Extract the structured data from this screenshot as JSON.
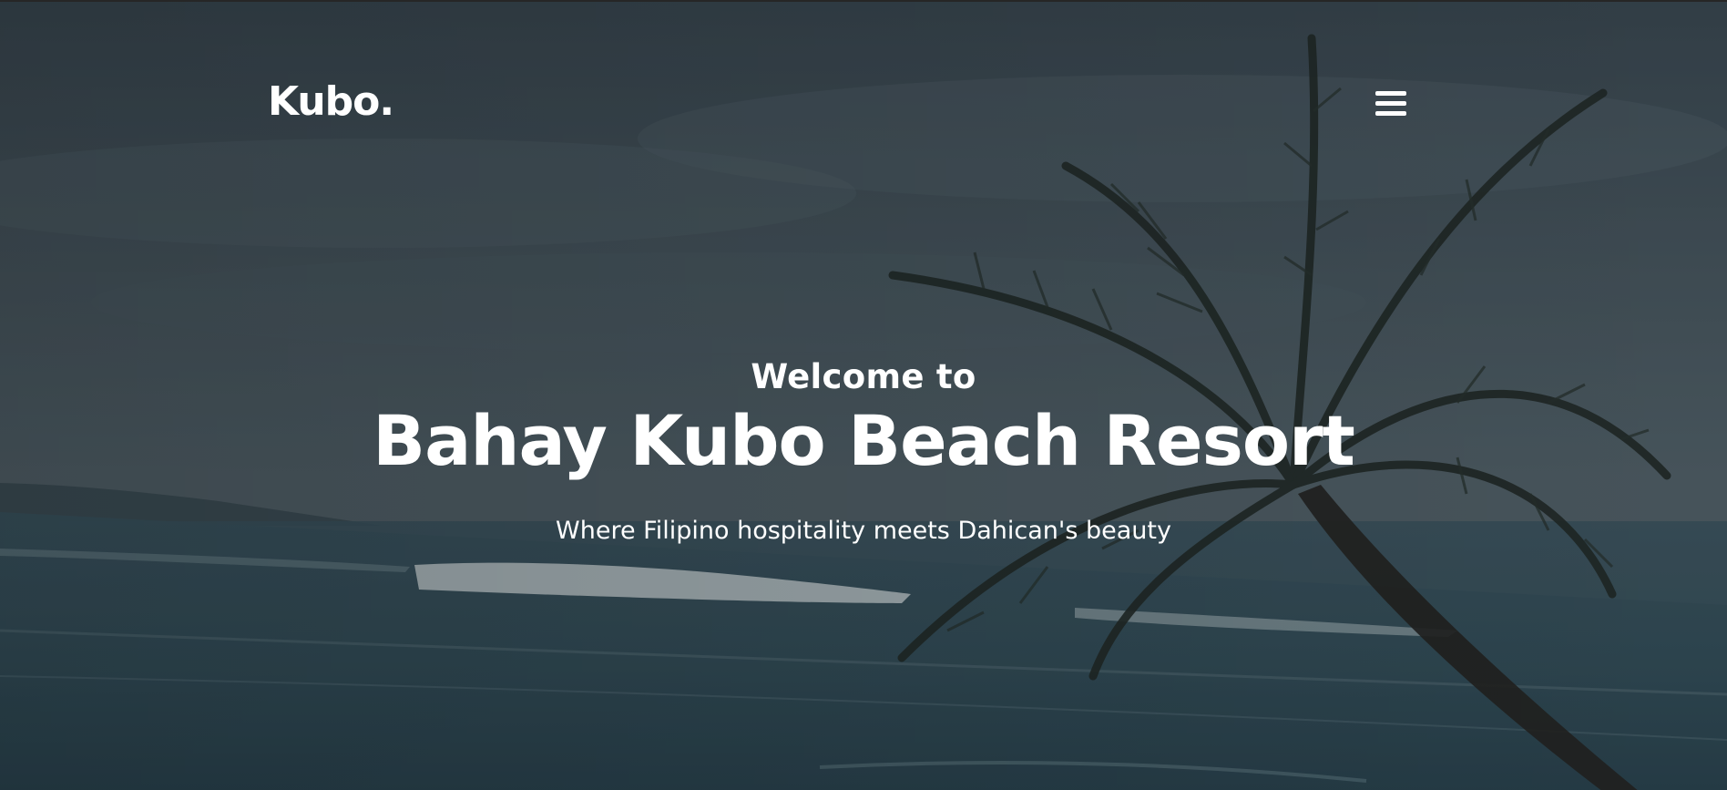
{
  "header": {
    "logo_text": "Kubo",
    "logo_dot": ".",
    "menu_icon": "hamburger-menu-icon"
  },
  "hero": {
    "welcome": "Welcome to",
    "title": "Bahay Kubo Beach Resort",
    "tagline": "Where Filipino hospitality meets Dahican's beauty"
  },
  "colors": {
    "text": "#ffffff",
    "overlay": "#2c3a44"
  }
}
